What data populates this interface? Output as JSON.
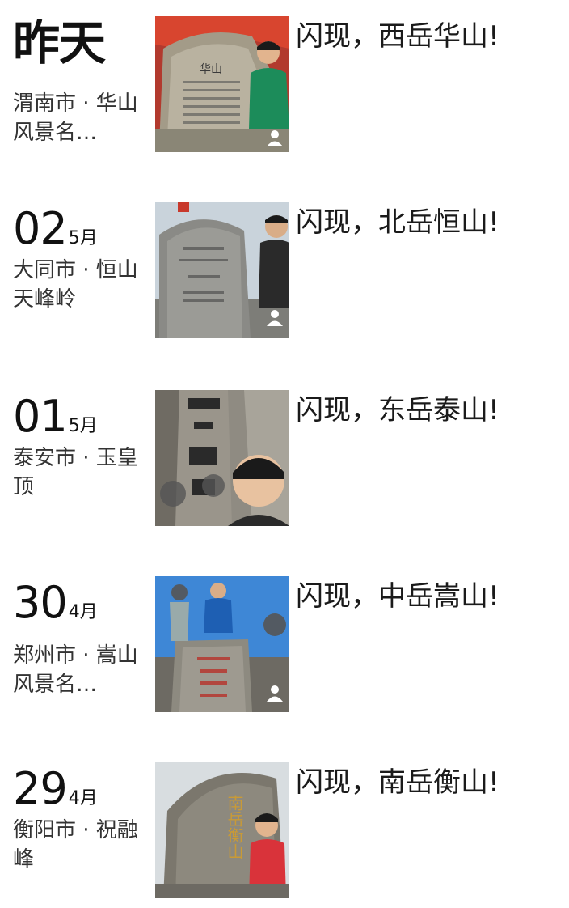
{
  "entries": [
    {
      "date_label": "昨天",
      "day": "",
      "month": "",
      "location": "渭南市 · 华山风景名…",
      "caption": "闪现，西岳华山!",
      "stone_text": "华山"
    },
    {
      "date_label": "",
      "day": "02",
      "month": "5月",
      "location": "大同市 · 恒山天峰岭",
      "caption": "闪现，北岳恒山!",
      "stone_text": ""
    },
    {
      "date_label": "",
      "day": "01",
      "month": "5月",
      "location": "泰安市 · 玉皇顶",
      "caption": "闪现，东岳泰山!",
      "stone_text": ""
    },
    {
      "date_label": "",
      "day": "30",
      "month": "4月",
      "location": "郑州市 · 嵩山风景名…",
      "caption": "闪现，中岳嵩山!",
      "stone_text": ""
    },
    {
      "date_label": "",
      "day": "29",
      "month": "4月",
      "location": "衡阳市 · 祝融峰",
      "caption": "闪现，南岳衡山!",
      "stone_text": "南岳衡山"
    }
  ],
  "colors": {
    "text": "#111111",
    "subtext": "#333333",
    "background": "#ffffff"
  },
  "icons": [
    "person-icon"
  ]
}
